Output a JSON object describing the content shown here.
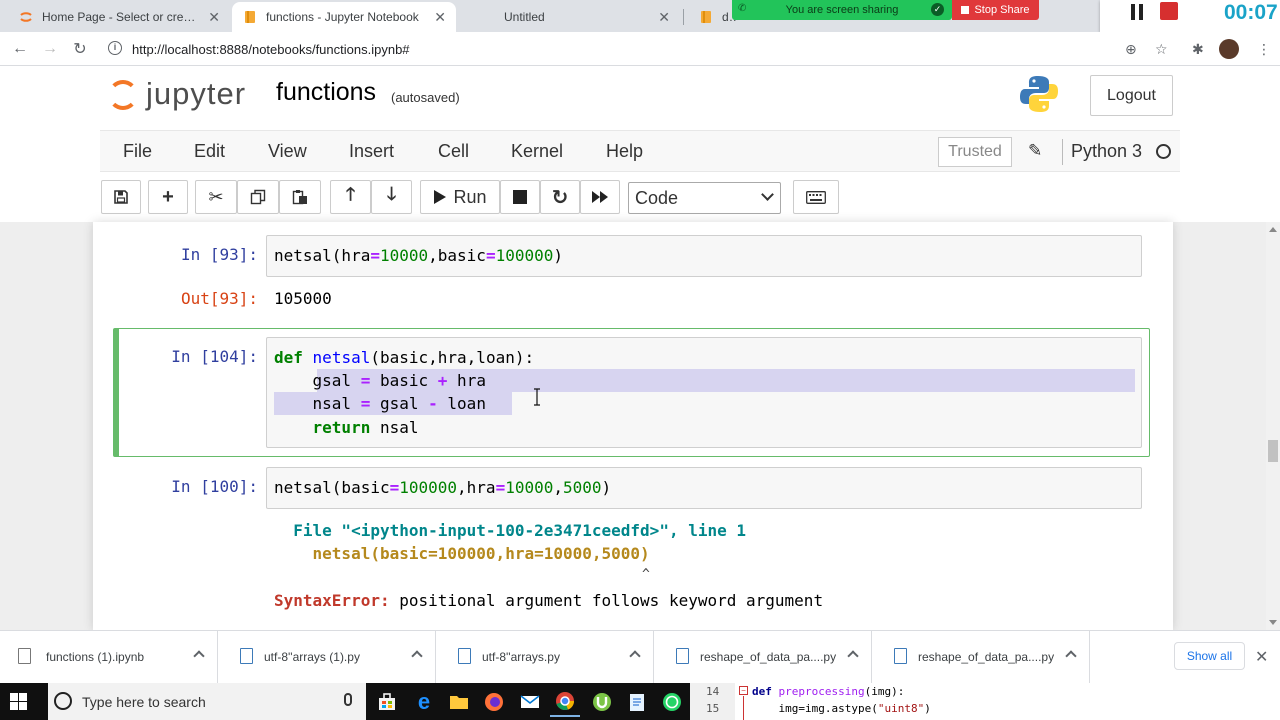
{
  "browser": {
    "tabs": [
      {
        "title": "Home Page - Select or create a notebook",
        "active": false
      },
      {
        "title": "functions - Jupyter Notebook",
        "active": true
      },
      {
        "title": "Untitled",
        "active": false
      },
      {
        "title": "data",
        "active": false
      }
    ],
    "url": "http://localhost:8888/notebooks/functions.ipynb#"
  },
  "screen_share": {
    "banner_text": "You are screen sharing",
    "stop_label": "Stop Share"
  },
  "recorder": {
    "time": "00:07"
  },
  "jupyter": {
    "logo_text": "jupyter",
    "notebook_name": "functions",
    "save_status": "(autosaved)",
    "logout_label": "Logout",
    "menu": [
      "File",
      "Edit",
      "View",
      "Insert",
      "Cell",
      "Kernel",
      "Help"
    ],
    "trusted_label": "Trusted",
    "kernel_name": "Python 3",
    "toolbar": {
      "run_label": "Run",
      "cell_type": "Code"
    }
  },
  "cells": [
    {
      "prompt": "In [93]:",
      "code": "netsal(hra=10000,basic=100000)",
      "out_prompt": "Out[93]:",
      "output": "105000"
    },
    {
      "prompt": "In [104]:",
      "lines": [
        "def netsal(basic,hra,loan):",
        "    gsal = basic + hra",
        "    nsal = gsal - loan",
        "    return nsal"
      ]
    },
    {
      "prompt": "In [100]:",
      "code": "netsal(basic=100000,hra=10000,5000)",
      "error": {
        "file_line": "  File \"<ipython-input-100-2e3471ceedfd>\", line 1",
        "code_line": "    netsal(basic=100000,hra=10000,5000)",
        "caret": "^",
        "error_name": "SyntaxError:",
        "error_msg": " positional argument follows keyword argument"
      }
    }
  ],
  "downloads": {
    "items": [
      "functions (1).ipynb",
      "utf-8''arrays (1).py",
      "utf-8''arrays.py",
      "reshape_of_data_pa....py",
      "reshape_of_data_pa....py"
    ],
    "show_all": "Show all"
  },
  "taskbar": {
    "search_placeholder": "Type here to search",
    "code_peek": {
      "lines": [
        {
          "num": "14",
          "text": "def preprocessing(img):"
        },
        {
          "num": "15",
          "text": "    img=img.astype(\"uint8\")"
        }
      ]
    }
  }
}
